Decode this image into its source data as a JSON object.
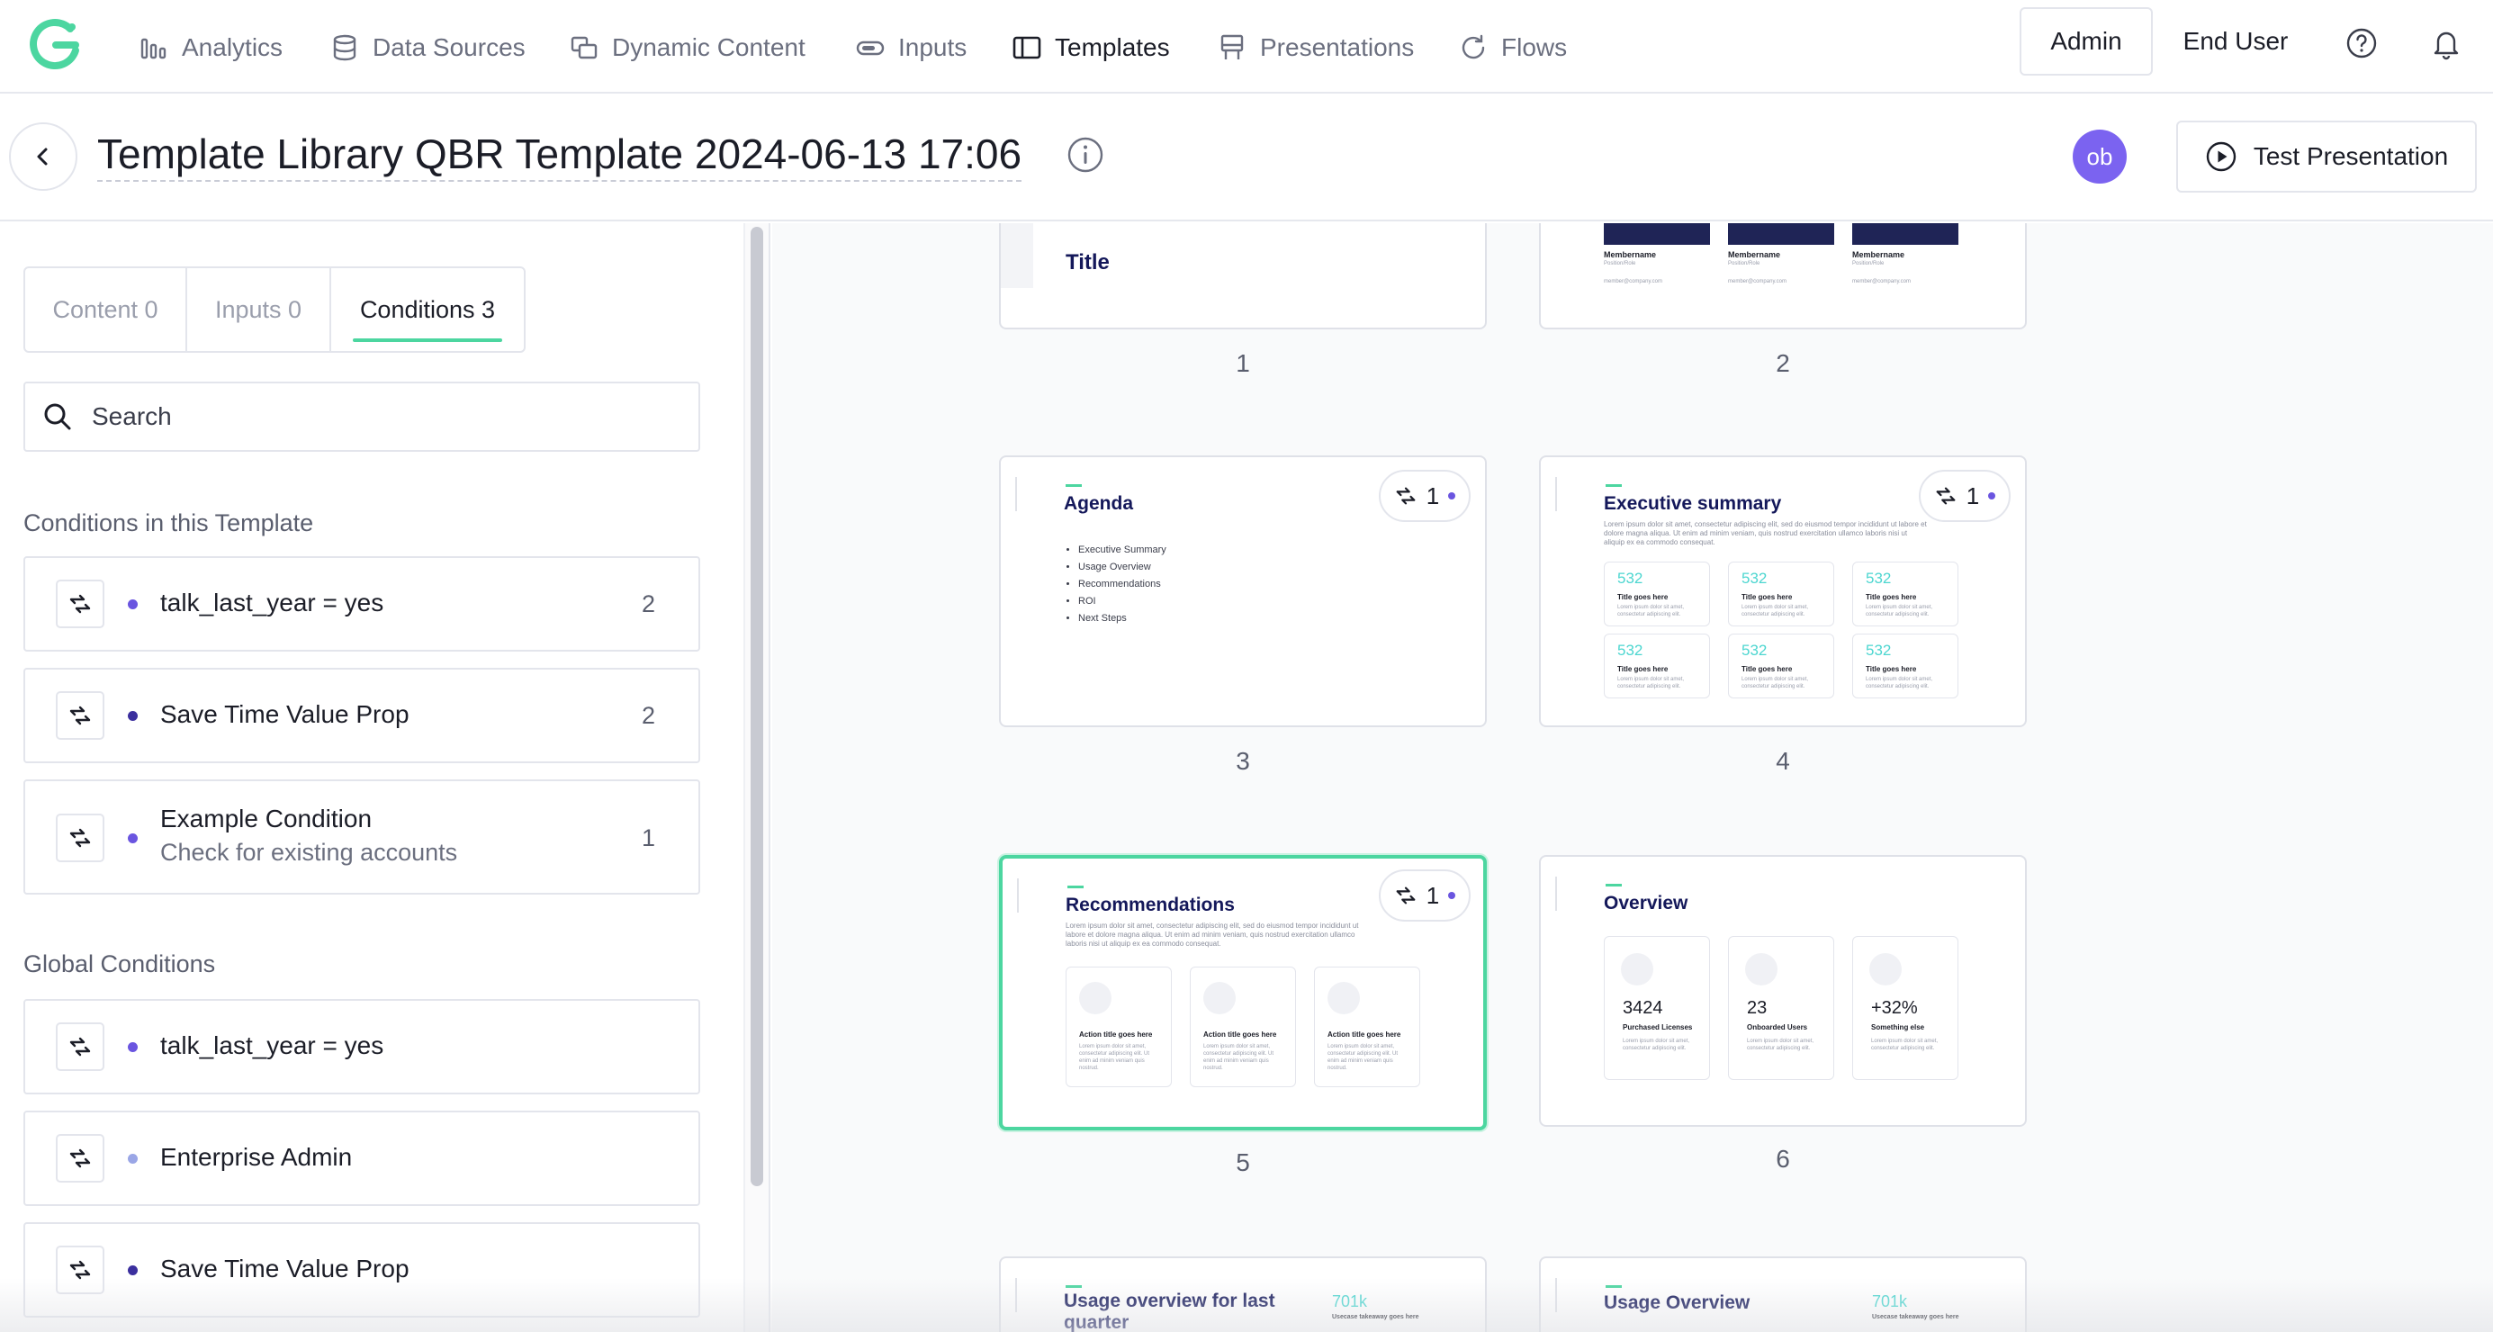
{
  "nav": {
    "items": [
      {
        "label": "Analytics",
        "icon": "analytics-icon"
      },
      {
        "label": "Data Sources",
        "icon": "database-icon"
      },
      {
        "label": "Dynamic Content",
        "icon": "dynamic-content-icon"
      },
      {
        "label": "Inputs",
        "icon": "toggle-icon"
      },
      {
        "label": "Templates",
        "icon": "template-icon",
        "active": true
      },
      {
        "label": "Presentations",
        "icon": "presentation-icon"
      },
      {
        "label": "Flows",
        "icon": "refresh-icon"
      }
    ],
    "roles": {
      "admin": "Admin",
      "end_user": "End User",
      "active": "Admin"
    }
  },
  "header": {
    "title": "Template Library QBR Template 2024-06-13 17:06",
    "avatar_initials": "ob",
    "test_button": "Test Presentation"
  },
  "sidebar": {
    "tabs": [
      {
        "label": "Content 0"
      },
      {
        "label": "Inputs 0"
      },
      {
        "label": "Conditions 3",
        "active": true
      }
    ],
    "search_placeholder": "Search",
    "template_section": "Conditions in this Template",
    "template_conditions": [
      {
        "name": "talk_last_year = yes",
        "count": "2",
        "dot": "#6a55e0"
      },
      {
        "name": "Save Time Value Prop",
        "count": "2",
        "dot": "#3b2f9e"
      },
      {
        "name": "Example Condition",
        "sub": "Check for existing accounts",
        "count": "1",
        "dot": "#6a55e0"
      }
    ],
    "global_section": "Global Conditions",
    "global_conditions": [
      {
        "name": "talk_last_year = yes",
        "dot": "#6a55e0"
      },
      {
        "name": "Enterprise Admin",
        "dot": "#9aa6e6"
      },
      {
        "name": "Save Time Value Prop",
        "dot": "#3b2f9e"
      }
    ]
  },
  "slides": {
    "s1": {
      "number": "1",
      "title": "Title"
    },
    "s2": {
      "number": "2",
      "member_name": "Membername",
      "member_sub": "Position/Role",
      "member_email": "member@company.com"
    },
    "s3": {
      "number": "3",
      "title": "Agenda",
      "badge": "1",
      "items": [
        "Executive Summary",
        "Usage Overview",
        "Recommendations",
        "ROI",
        "Next Steps"
      ]
    },
    "s4": {
      "number": "4",
      "title": "Executive summary",
      "badge": "1",
      "kpi": "532",
      "kpi_title": "Title goes here",
      "kpi_text": "Lorem ipsum dolor sit amet, consectetur adipiscing elit."
    },
    "s5": {
      "number": "5",
      "title": "Recommendations",
      "badge": "1",
      "action_title": "Action title goes here",
      "action_text": "Lorem ipsum dolor sit amet, consectetur adipiscing elit. Ut enim ad minim veniam quis nostrud."
    },
    "s6": {
      "number": "6",
      "title": "Overview",
      "stats": [
        {
          "value": "3424",
          "label": "Purchased Licenses"
        },
        {
          "value": "23",
          "label": "Onboarded Users"
        },
        {
          "value": "+32%",
          "label": "Something else"
        }
      ],
      "stat_text": "Lorem ipsum dolor sit amet, consectetur adipiscing elit."
    },
    "s7": {
      "title": "Usage overview for last quarter",
      "kpi": "701k",
      "kpi_label": "Usecase takeaway goes here"
    },
    "s8": {
      "title": "Usage Overview",
      "kpi": "701k",
      "kpi_label": "Usecase takeaway goes here"
    },
    "body_text": "Lorem ipsum dolor sit amet, consectetur adipiscing elit, sed do eiusmod tempor incididunt ut labore et dolore magna aliqua. Ut enim ad minim veniam, quis nostrud exercitation ullamco laboris nisi ut aliquip ex ea commodo consequat."
  }
}
